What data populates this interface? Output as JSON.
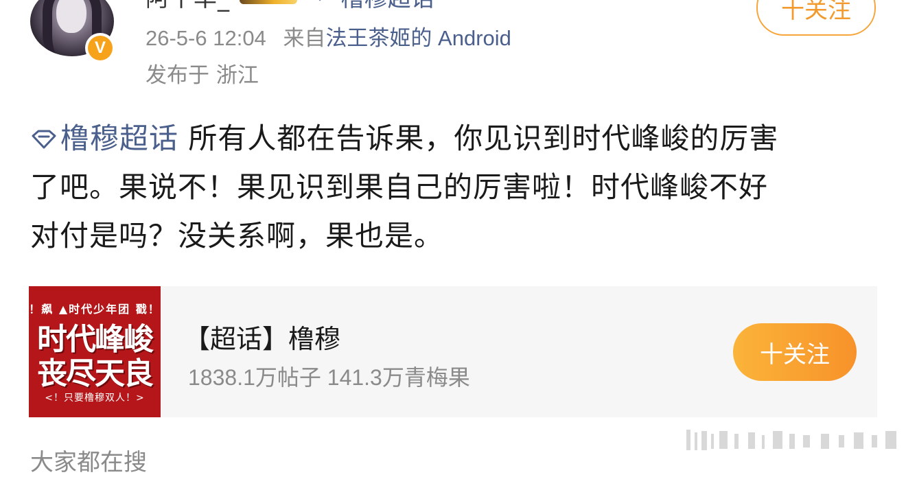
{
  "header": {
    "username": "阿十率_",
    "topic_link": "橹穆超话",
    "follow_label": "十关注",
    "timestamp": "26-5-6 12:04",
    "source_prefix": "来自",
    "source": "法王茶姬的 Android",
    "location": "发布于 浙江"
  },
  "post": {
    "tag": "橹穆超话",
    "line1": " 所有人都在告诉果，你见识到时代峰峻的厉害",
    "line2": "了吧。果说不！果见识到果自己的厉害啦！时代峰峻不好",
    "line3": "对付是吗？没关系啊，果也是。"
  },
  "card": {
    "cover_top": "！飙  ▲时代少年团  戳！",
    "cover_big1": "时代峰峻",
    "cover_big2": "丧尽天良",
    "cover_bottom": "<！只要橹穆双人！>",
    "title": "【超话】橹穆",
    "stats": "1838.1万帖子 141.3万青梅果",
    "follow_label": "十关注"
  },
  "footer": {
    "partial_text": "大家都在搜"
  },
  "badge": {
    "verified_letter": "V"
  },
  "colors": {
    "link": "#4a5f8c",
    "accent": "#f7a43a",
    "cover_red": "#b5161a"
  },
  "icons": [
    "avatar",
    "verified-badge-icon",
    "medal-icon",
    "topic-arrow-icon",
    "supertopic-diamond-icon"
  ]
}
